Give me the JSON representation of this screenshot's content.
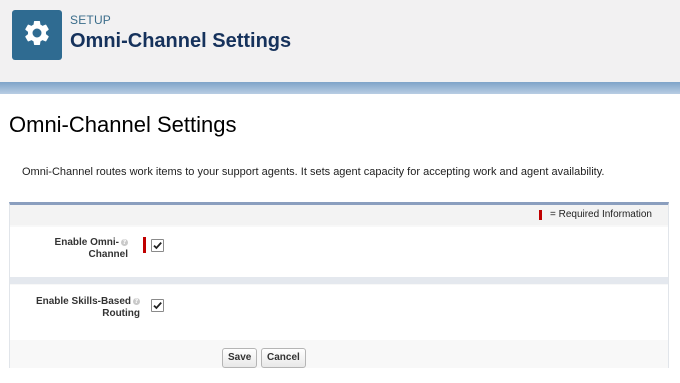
{
  "header": {
    "section_label": "SETUP",
    "title": "Omni-Channel Settings",
    "icon": "gear-icon"
  },
  "page": {
    "title": "Omni-Channel Settings",
    "description": "Omni-Channel routes work items to your support agents. It sets agent capacity for accepting work and agent availability."
  },
  "settings": {
    "required_legend": "= Required Information",
    "fields": [
      {
        "label_line1": "Enable Omni-",
        "label_line2": "Channel",
        "checked": true,
        "required": true
      },
      {
        "label_line1": "Enable Skills-Based",
        "label_line2": "Routing",
        "checked": true,
        "required": false
      }
    ]
  },
  "buttons": {
    "save": "Save",
    "cancel": "Cancel"
  },
  "colors": {
    "brand_tile": "#2f6b91",
    "title_text": "#16325c",
    "required_red": "#c00000",
    "block_border": "#8a9ebe"
  }
}
